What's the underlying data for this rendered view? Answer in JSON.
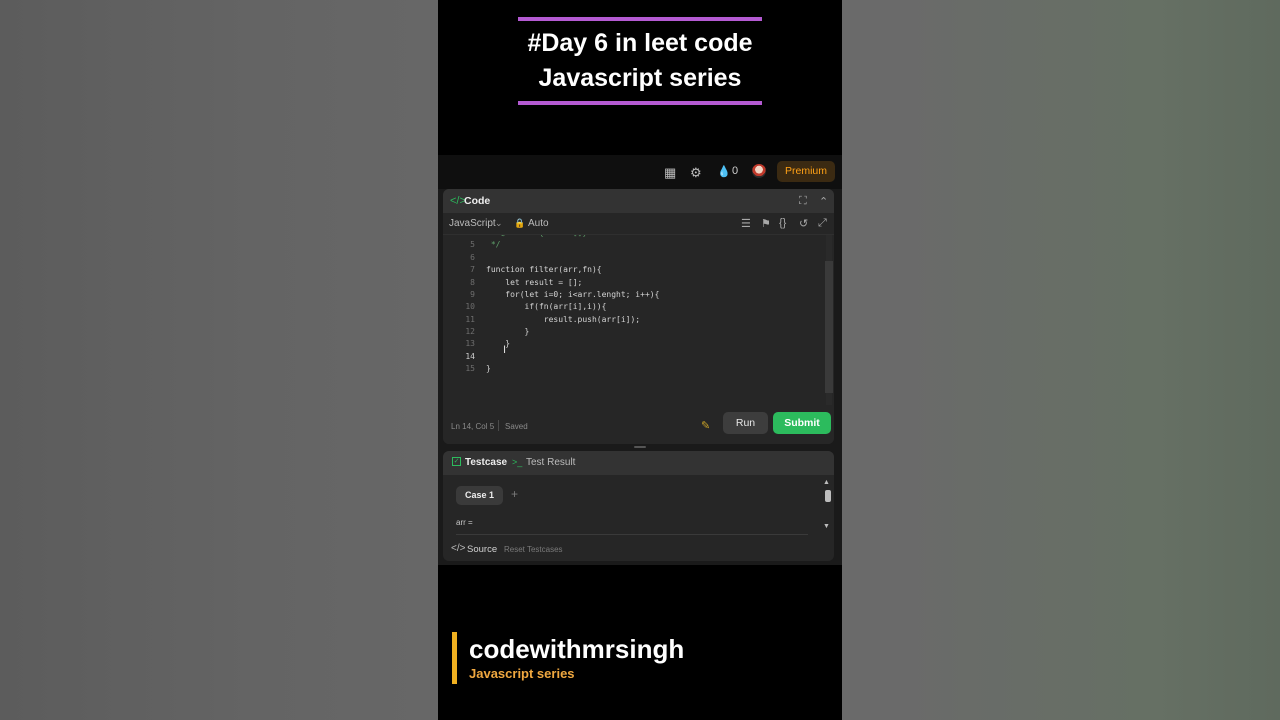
{
  "overlay": {
    "title_line1": "#Day 6 in leet code",
    "title_line2": "Javascript series"
  },
  "topbar": {
    "icons": [
      "layout-icon",
      "gear-icon",
      "flame-icon"
    ],
    "streak_count": "0",
    "premium_label": "Premium"
  },
  "code_panel": {
    "title": "Code",
    "language": "JavaScript",
    "mode": "Auto",
    "line_numbers": [
      "5",
      "6",
      "7",
      "8",
      "9",
      "10",
      "11",
      "12",
      "13",
      "14",
      "15"
    ],
    "lines": [
      " */",
      "",
      "function filter(arr,fn){",
      "    let result = [];",
      "    for(let i=0; i<arr.lenght; i++){",
      "        if(fn(arr[i],i)){",
      "            result.push(arr[i]);",
      "        }",
      "    }",
      "",
      "}"
    ],
    "status_position": "Ln 14, Col 5",
    "status_saved": "Saved",
    "run_label": "Run",
    "submit_label": "Submit"
  },
  "test_panel": {
    "testcase_tab": "Testcase",
    "result_tab": "Test Result",
    "case_tab": "Case 1",
    "arr_label": "arr =",
    "source_label": "Source",
    "reset_label": "Reset Testcases"
  },
  "brand": {
    "name": "codewithmrsingh",
    "subtitle": "Javascript series"
  },
  "colors": {
    "accent_purple": "#b45ad2",
    "submit_green": "#2cbb5d",
    "premium_orange": "#ffa116",
    "brand_yellow": "#f0b020"
  }
}
